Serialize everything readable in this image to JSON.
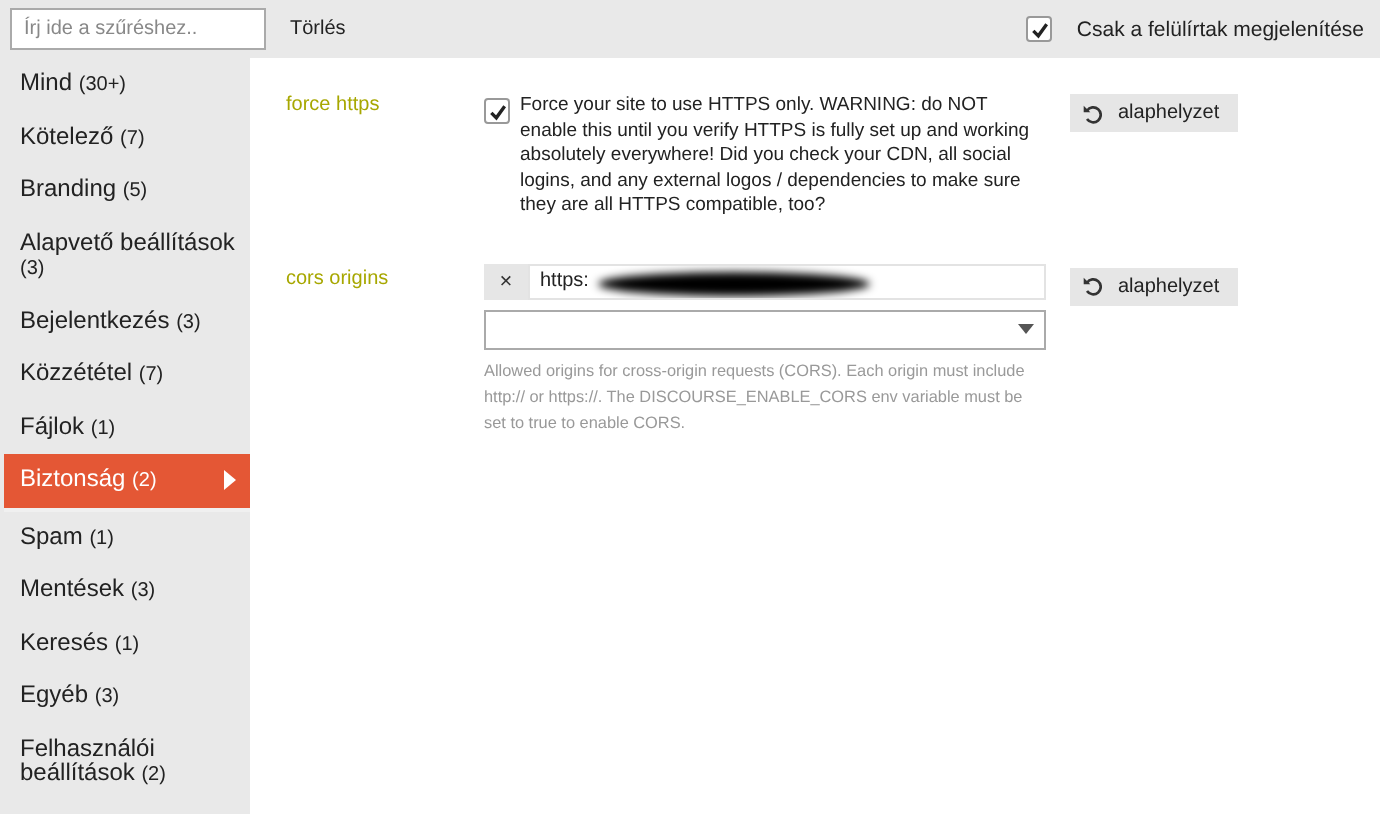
{
  "filter": {
    "placeholder": "Írj ide a szűréshez.."
  },
  "clear_button": "Törlés",
  "overridden_only": {
    "label": "Csak a felülírtak megjelenítése",
    "checked": true
  },
  "sidebar": {
    "items": [
      {
        "label": "Mind",
        "count": "(30+)",
        "selected": false
      },
      {
        "label": "Kötelező",
        "count": "(7)",
        "selected": false
      },
      {
        "label": "Branding",
        "count": "(5)",
        "selected": false
      },
      {
        "label": "Alapvető beállítások",
        "count": "(3)",
        "selected": false
      },
      {
        "label": "Bejelentkezés",
        "count": "(3)",
        "selected": false
      },
      {
        "label": "Közzététel",
        "count": "(7)",
        "selected": false
      },
      {
        "label": "Fájlok",
        "count": "(1)",
        "selected": false
      },
      {
        "label": "Biztonság",
        "count": "(2)",
        "selected": true
      },
      {
        "label": "Spam",
        "count": "(1)",
        "selected": false
      },
      {
        "label": "Mentések",
        "count": "(3)",
        "selected": false
      },
      {
        "label": "Keresés",
        "count": "(1)",
        "selected": false
      },
      {
        "label": "Egyéb",
        "count": "(3)",
        "selected": false
      },
      {
        "label": "Felhasználói beállítások",
        "count": "(2)",
        "selected": false
      }
    ]
  },
  "settings": [
    {
      "kind": "checkbox",
      "name": "force https",
      "checked": true,
      "description": "Force your site to use HTTPS only. WARNING: do NOT enable this until you verify HTTPS is fully set up and working absolutely everywhere! Did you check your CDN, all social logins, and any external logos / dependencies to make sure they are all HTTPS compatible, too?",
      "reset_button": "alaphelyzet"
    },
    {
      "kind": "list",
      "name": "cors origins",
      "values": [
        {
          "remove": "×",
          "value": "https:"
        }
      ],
      "description": "Allowed origins for cross-origin requests (CORS). Each origin must include http:// or https://. The DISCOURSE_ENABLE_CORS env variable must be set to true to enable CORS.",
      "reset_button": "alaphelyzet"
    }
  ]
}
